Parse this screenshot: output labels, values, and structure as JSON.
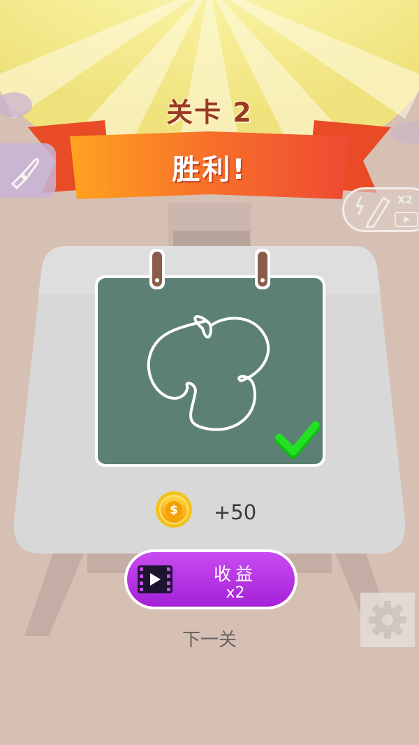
{
  "level": {
    "title": "关卡 2"
  },
  "result": {
    "text": "胜利!"
  },
  "reward": {
    "coins": "+50"
  },
  "buttons": {
    "reward_label": "收益",
    "reward_multiplier": "x2",
    "next_level": "下一关",
    "speed_multiplier": "X2"
  },
  "icons": {
    "brush": "brush-icon",
    "pencil_boost": "pencil-lightning-icon",
    "video": "video-icon",
    "coin": "coin-icon",
    "check": "checkmark-icon",
    "settings": "gear-icon"
  },
  "colors": {
    "background": "#d6c0b4",
    "banner": "#f15a2c",
    "board": "#5d8076",
    "reward_button": "#b533e3",
    "check": "#1fd31f",
    "coin": "#f7b500"
  }
}
